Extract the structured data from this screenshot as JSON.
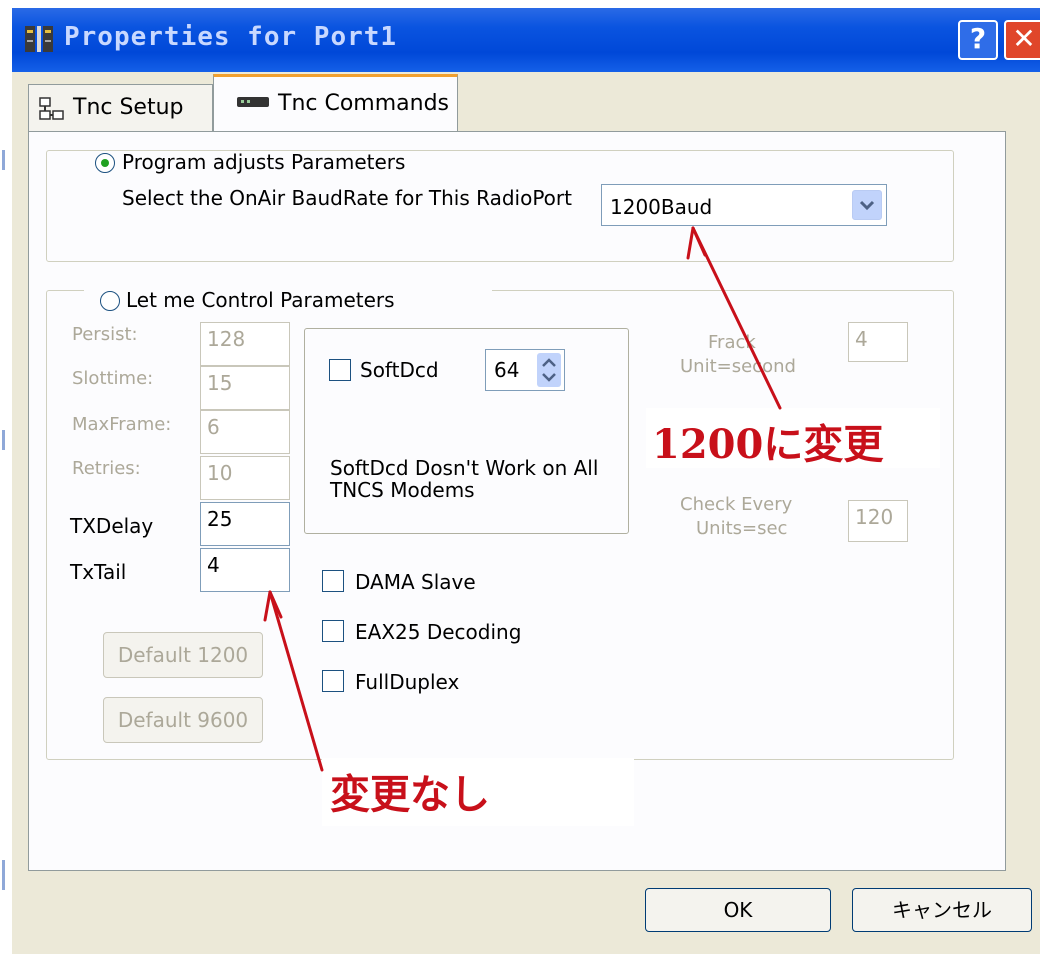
{
  "window": {
    "title": "Properties for Port1",
    "help_glyph": "?",
    "close_glyph": "✕"
  },
  "tabs": [
    {
      "label": "Tnc Setup",
      "icon": "network-icon",
      "selected": false
    },
    {
      "label": "Tnc Commands",
      "icon": "tnc-device-icon",
      "selected": true
    }
  ],
  "program_group": {
    "radio_label": "Program adjusts Parameters",
    "radio_checked": true,
    "baud_prompt": "Select the OnAir BaudRate for This RadioPort",
    "baud_value": "1200Baud"
  },
  "manual_group": {
    "radio_label": "Let me Control Parameters",
    "radio_checked": false,
    "params": [
      {
        "label": "Persist:",
        "value": "128",
        "enabled": false
      },
      {
        "label": "Slottime:",
        "value": "15",
        "enabled": false
      },
      {
        "label": "MaxFrame:",
        "value": "6",
        "enabled": false
      },
      {
        "label": "Retries:",
        "value": "10",
        "enabled": false
      },
      {
        "label": "TXDelay",
        "value": "25",
        "enabled": true
      },
      {
        "label": "TxTail",
        "value": "4",
        "enabled": true
      }
    ],
    "default_1200": "Default 1200",
    "default_9600": "Default 9600",
    "softdcd": {
      "label": "SoftDcd",
      "checked": false,
      "value": "64",
      "note_line1": "SoftDcd Dosn't Work on All",
      "note_line2": "TNCS  Modems"
    },
    "frack": {
      "label_line1": "Frack",
      "label_line2": "Unit=second",
      "value": "4"
    },
    "check": {
      "label_line1": "Check Every",
      "label_line2": "Units=sec",
      "value": "120"
    },
    "checkboxes": [
      {
        "label": "DAMA Slave",
        "checked": false
      },
      {
        "label": "EAX25 Decoding",
        "checked": false
      },
      {
        "label": "FullDuplex",
        "checked": false
      }
    ]
  },
  "footer": {
    "ok": "OK",
    "cancel": "キャンセル"
  },
  "annotations": {
    "changed": "1200に変更",
    "unchanged": "変更なし",
    "color": "#c8101a"
  }
}
